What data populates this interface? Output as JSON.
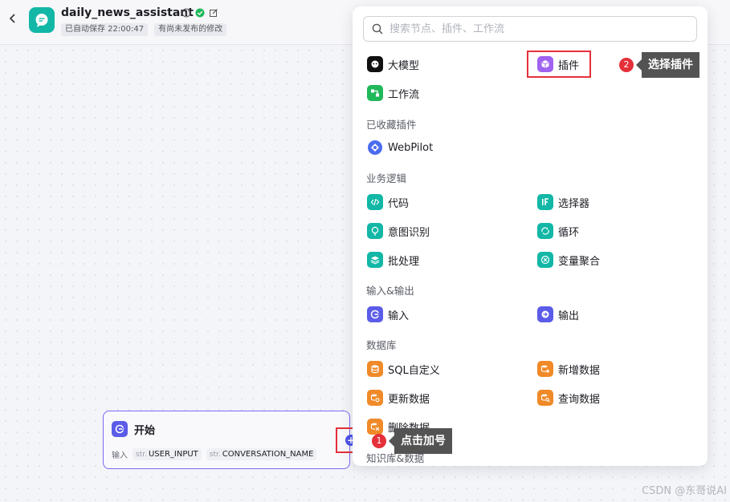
{
  "header": {
    "back_icon": "chevron-left-icon",
    "title": "daily_news_assistant",
    "badges": [
      "已自动保存 22:00:47",
      "有尚未发布的修改"
    ]
  },
  "panel": {
    "search_placeholder": "搜索节点、插件、工作流",
    "top_items": [
      {
        "label": "大模型",
        "icon": "llm-icon"
      },
      {
        "label": "插件",
        "icon": "plugin-icon"
      },
      {
        "label": "工作流",
        "icon": "workflow-icon"
      }
    ],
    "sections": {
      "favorites": {
        "title": "已收藏插件",
        "items": [
          "WebPilot"
        ]
      },
      "business": {
        "title": "业务逻辑",
        "items": [
          "代码",
          "选择器",
          "意图识别",
          "循环",
          "批处理",
          "变量聚合"
        ]
      },
      "io": {
        "title": "输入&输出",
        "items": [
          "输入",
          "输出"
        ]
      },
      "database": {
        "title": "数据库",
        "items": [
          "SQL自定义",
          "新增数据",
          "更新数据",
          "查询数据",
          "删除数据"
        ]
      },
      "knowledge": {
        "title": "知识库&数据"
      }
    }
  },
  "start_node": {
    "title": "开始",
    "input_label": "输入",
    "params": [
      {
        "type": "str.",
        "name": "USER_INPUT"
      },
      {
        "type": "str.",
        "name": "CONVERSATION_NAME"
      }
    ]
  },
  "annotations": {
    "step1": {
      "num": "1",
      "text": "点击加号"
    },
    "step2": {
      "num": "2",
      "text": "选择插件"
    }
  },
  "watermark": "CSDN @东哥说AI",
  "colors": {
    "accent": "#4d53e8",
    "highlight": "#e5303a",
    "teal": "#12b7a6",
    "green": "#1fb85a",
    "orange": "#f08a28",
    "purple": "#a063f0"
  }
}
